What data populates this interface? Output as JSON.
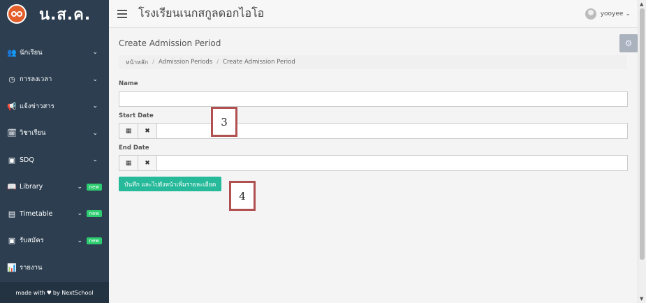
{
  "brand": {
    "name": "น.ส.ค."
  },
  "topbar": {
    "school_name": "โรงเรียนเนกสกูลดอกไอโอ",
    "user_name": "yooyee",
    "user_chevron": "⌄"
  },
  "sidebar": {
    "items": [
      {
        "label": "นักเรียน",
        "icon": "users-icon",
        "glyph": "👥",
        "chevron": "⌄",
        "badge": ""
      },
      {
        "label": "การลงเวลา",
        "icon": "clock-icon",
        "glyph": "◷",
        "chevron": "⌄",
        "badge": ""
      },
      {
        "label": "แจ้งข่าวสาร",
        "icon": "bullhorn-icon",
        "glyph": "📢",
        "chevron": "⌄",
        "badge": ""
      },
      {
        "label": "วิชาเรียน",
        "icon": "calendar-check-icon",
        "glyph": "🗓",
        "chevron": "⌄",
        "badge": ""
      },
      {
        "label": "SDQ",
        "icon": "document-icon",
        "glyph": "▣",
        "chevron": "⌄",
        "badge": ""
      },
      {
        "label": "Library",
        "icon": "book-icon",
        "glyph": "📖",
        "chevron": "⌄",
        "badge": "new"
      },
      {
        "label": "Timetable",
        "icon": "timetable-icon",
        "glyph": "▤",
        "chevron": "⌄",
        "badge": "new"
      },
      {
        "label": "รับสมัคร",
        "icon": "admission-icon",
        "glyph": "▣",
        "chevron": "⌄",
        "badge": "new"
      },
      {
        "label": "รายงาน",
        "icon": "bar-chart-icon",
        "glyph": "📊",
        "chevron": "",
        "badge": ""
      }
    ],
    "footer": {
      "prefix": "made with",
      "heart": "♥",
      "suffix": "by NextSchool"
    }
  },
  "page": {
    "title": "Create Admission Period",
    "breadcrumb": [
      "หน้าหลัก",
      "Admission Periods",
      "Create Admission Period"
    ],
    "breadcrumb_sep": "/",
    "gear_glyph": "⚙"
  },
  "form": {
    "name_label": "Name",
    "name_value": "",
    "start_label": "Start Date",
    "start_value": "",
    "end_label": "End Date",
    "end_value": "",
    "calendar_glyph": "▦",
    "clear_glyph": "✖",
    "submit_label": "บันทึก และไปยังหน้าเพิ่มรายละเอียด"
  },
  "callouts": {
    "first": "3",
    "second": "4"
  },
  "scrollbar": {
    "up": "▲",
    "down": "▼"
  },
  "colors": {
    "sidebar_bg": "#2c3e50",
    "accent": "#26b99a",
    "badge": "#2ecc71",
    "callout_border": "#b05050"
  }
}
